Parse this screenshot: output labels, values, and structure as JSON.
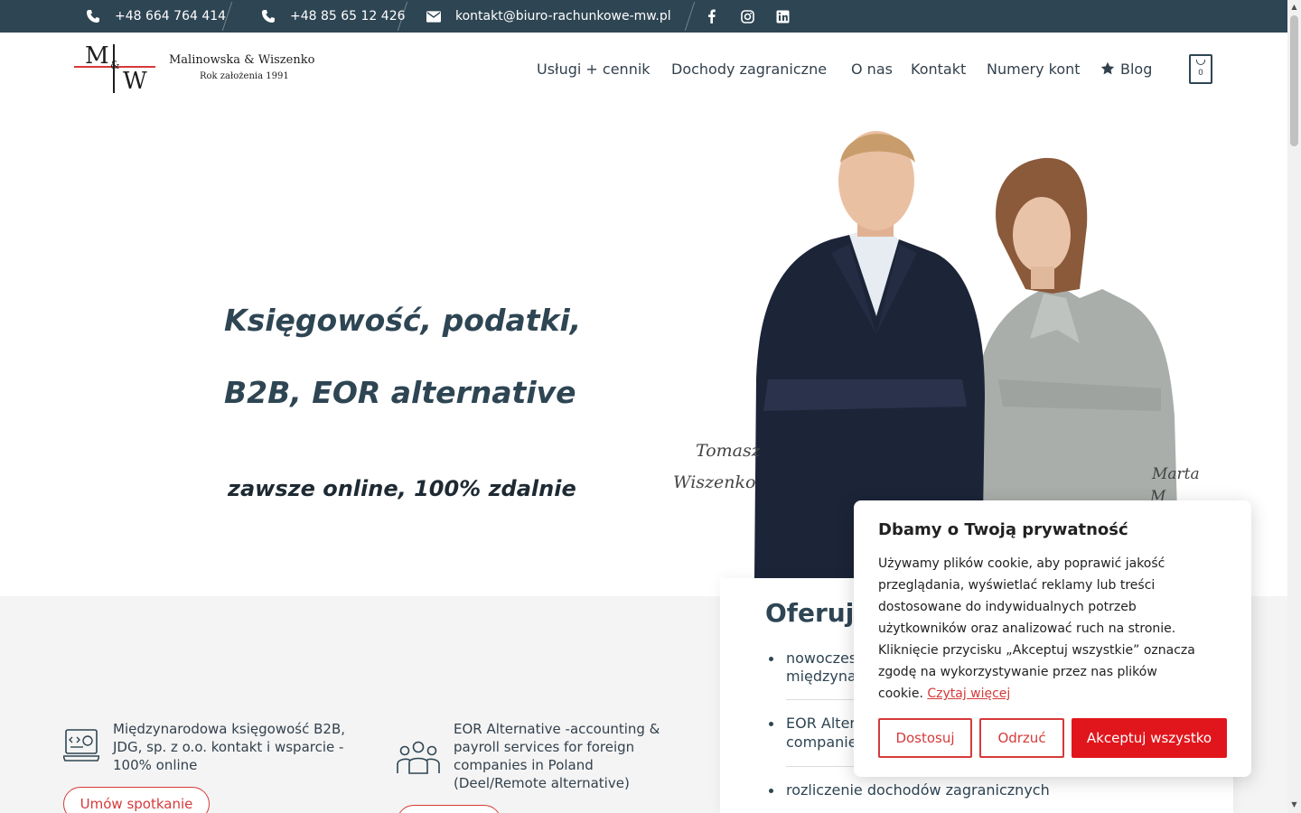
{
  "topbar": {
    "phone1": "+48 664 764 414",
    "phone2": "+48 85 65 12 426",
    "email": "kontakt@biuro-rachunkowe-mw.pl",
    "social": [
      "facebook-icon",
      "instagram-icon",
      "linkedin-icon"
    ]
  },
  "logo": {
    "letter_m": "M",
    "letter_w": "W",
    "ampersand": "&",
    "name": "Malinowska & Wiszenko",
    "year": "Rok założenia 1991"
  },
  "nav": {
    "items": [
      "Usługi + cennik",
      "Dochody zagraniczne",
      "O nas",
      "Kontakt",
      "Numery kont",
      "Blog"
    ],
    "cart_count": "0"
  },
  "hero": {
    "line1": "Księgowość, podatki,",
    "line2": "B2B, EOR alternative",
    "subtitle": "zawsze online, 100% zdalnie",
    "signature1_line1": "Tomasz",
    "signature1_line2": "Wiszenko",
    "signature2_line1": "Marta",
    "signature2_line2": "M"
  },
  "features": [
    {
      "text": "Międzynarodowa księgowość B2B, JDG, sp. z o.o. kontakt i wsparcie - 100% online",
      "button": "Umów spotkanie"
    },
    {
      "text": "EOR Alternative -accounting & payroll services for foreign companies in Poland (Deel/Remote alternative)",
      "button": ""
    }
  ],
  "offer": {
    "title": "Oferuje",
    "items": [
      {
        "line1": "nowoczes",
        "line2": "międzyna"
      },
      {
        "line1": "EOR Alter",
        "line2": "companie"
      },
      {
        "line1": "rozliczenie dochodów zagranicznych",
        "line2": ""
      }
    ]
  },
  "cookie": {
    "title": "Dbamy o Twoją prywatność",
    "text": "Używamy plików cookie, aby poprawić jakość przeglądania, wyświetlać reklamy lub treści dostosowane do indywidualnych potrzeb użytkowników oraz analizować ruch na stronie. Kliknięcie przycisku „Akceptuj wszystkie” oznacza zgodę na wykorzystywanie przez nas plików cookie.",
    "link": "Czytaj więcej",
    "customize": "Dostosuj",
    "reject": "Odrzuć",
    "accept": "Akceptuj wszystko"
  },
  "colors": {
    "topbar": "#2e4553",
    "accent": "#d63a3a",
    "accept_button": "#e1161c",
    "text": "#33414d"
  }
}
